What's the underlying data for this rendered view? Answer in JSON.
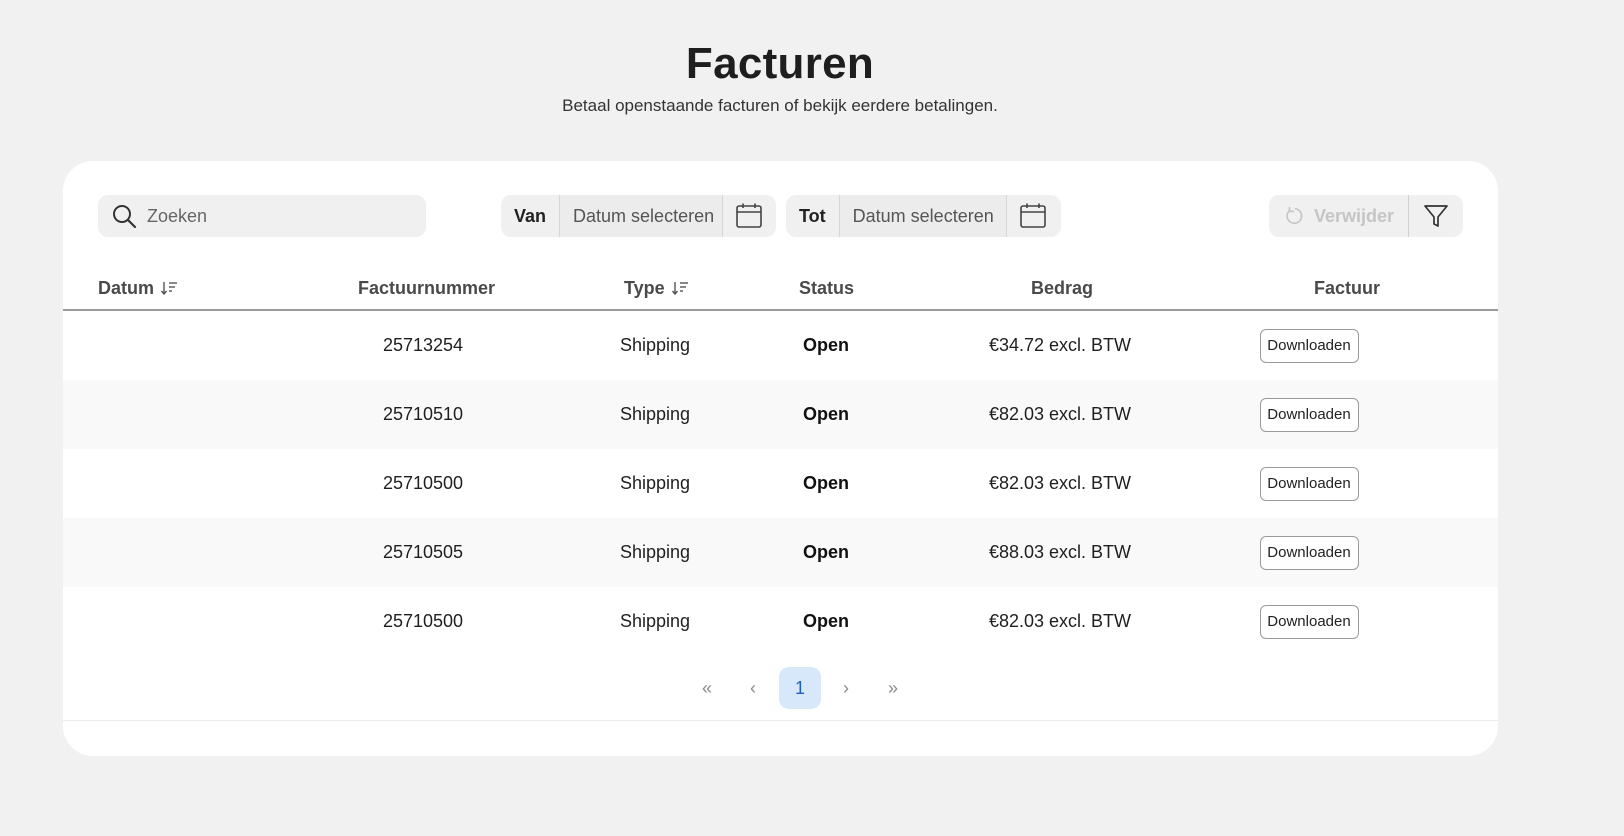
{
  "page": {
    "title": "Facturen",
    "subtitle": "Betaal openstaande facturen of bekijk eerdere betalingen."
  },
  "toolbar": {
    "search_placeholder": "Zoeken",
    "from_label": "Van",
    "from_placeholder": "Datum selecteren",
    "to_label": "Tot",
    "to_placeholder": "Datum selecteren",
    "reset_label": "Verwijder"
  },
  "table": {
    "columns": {
      "datum": "Datum",
      "factuurnummer": "Factuurnummer",
      "type": "Type",
      "status": "Status",
      "bedrag": "Bedrag",
      "factuur": "Factuur"
    },
    "rows": [
      {
        "datum": "",
        "factuurnummer": "25713254",
        "type": "Shipping",
        "status": "Open",
        "bedrag": "€34.72 excl. BTW",
        "action": "Downloaden"
      },
      {
        "datum": "",
        "factuurnummer": "25710510",
        "type": "Shipping",
        "status": "Open",
        "bedrag": "€82.03 excl. BTW",
        "action": "Downloaden"
      },
      {
        "datum": "",
        "factuurnummer": "25710500",
        "type": "Shipping",
        "status": "Open",
        "bedrag": "€82.03 excl. BTW",
        "action": "Downloaden"
      },
      {
        "datum": "",
        "factuurnummer": "25710505",
        "type": "Shipping",
        "status": "Open",
        "bedrag": "€88.03 excl. BTW",
        "action": "Downloaden"
      },
      {
        "datum": "",
        "factuurnummer": "25710500",
        "type": "Shipping",
        "status": "Open",
        "bedrag": "€82.03 excl. BTW",
        "action": "Downloaden"
      }
    ]
  },
  "pagination": {
    "first": "«",
    "prev": "‹",
    "current": "1",
    "next": "›",
    "last": "»"
  },
  "icons": {
    "search": "search-icon",
    "calendar": "calendar-icon",
    "reset": "reset-icon",
    "filter": "filter-icon",
    "sort": "sort-icon"
  },
  "colors": {
    "background": "#f1f1f1",
    "card": "#ffffff",
    "active_page_bg": "#d7e8fb",
    "active_page_text": "#1d5fbf",
    "disabled_text": "#c5c5c5"
  }
}
